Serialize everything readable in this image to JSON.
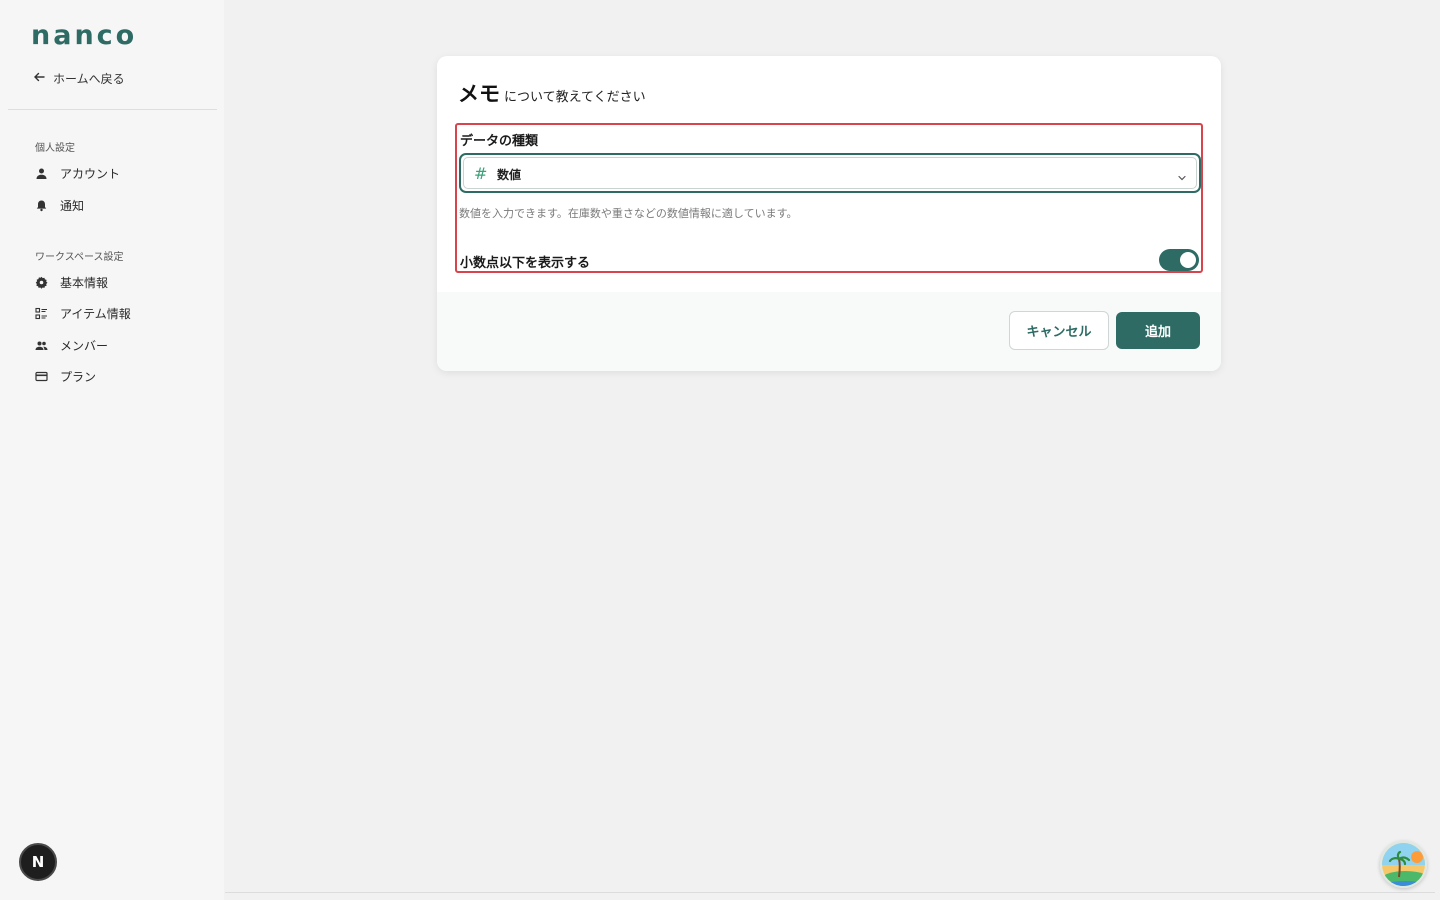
{
  "sidebar": {
    "logo": "nanco",
    "back_label": "ホームへ戻る",
    "personal_section": "個人設定",
    "personal_items": [
      {
        "label": "アカウント",
        "icon": "person-icon"
      },
      {
        "label": "通知",
        "icon": "bell-icon"
      }
    ],
    "workspace_section": "ワークスペース設定",
    "workspace_items": [
      {
        "label": "基本情報",
        "icon": "gear-icon"
      },
      {
        "label": "アイテム情報",
        "icon": "list-icon"
      },
      {
        "label": "メンバー",
        "icon": "people-icon"
      },
      {
        "label": "プラン",
        "icon": "card-icon"
      }
    ],
    "avatar_initial": "N"
  },
  "dialog": {
    "title_main": "メモ",
    "title_sub": "について教えてください",
    "data_type_label": "データの種類",
    "data_type_value": "数値",
    "data_type_help": "数値を入力できます。在庫数や重さなどの数値情報に適しています。",
    "decimal_toggle_label": "小数点以下を表示する",
    "decimal_toggle_on": true,
    "cancel_label": "キャンセル",
    "add_label": "追加"
  },
  "colors": {
    "accent": "#2d6b64",
    "highlight_border": "#d9434b"
  }
}
